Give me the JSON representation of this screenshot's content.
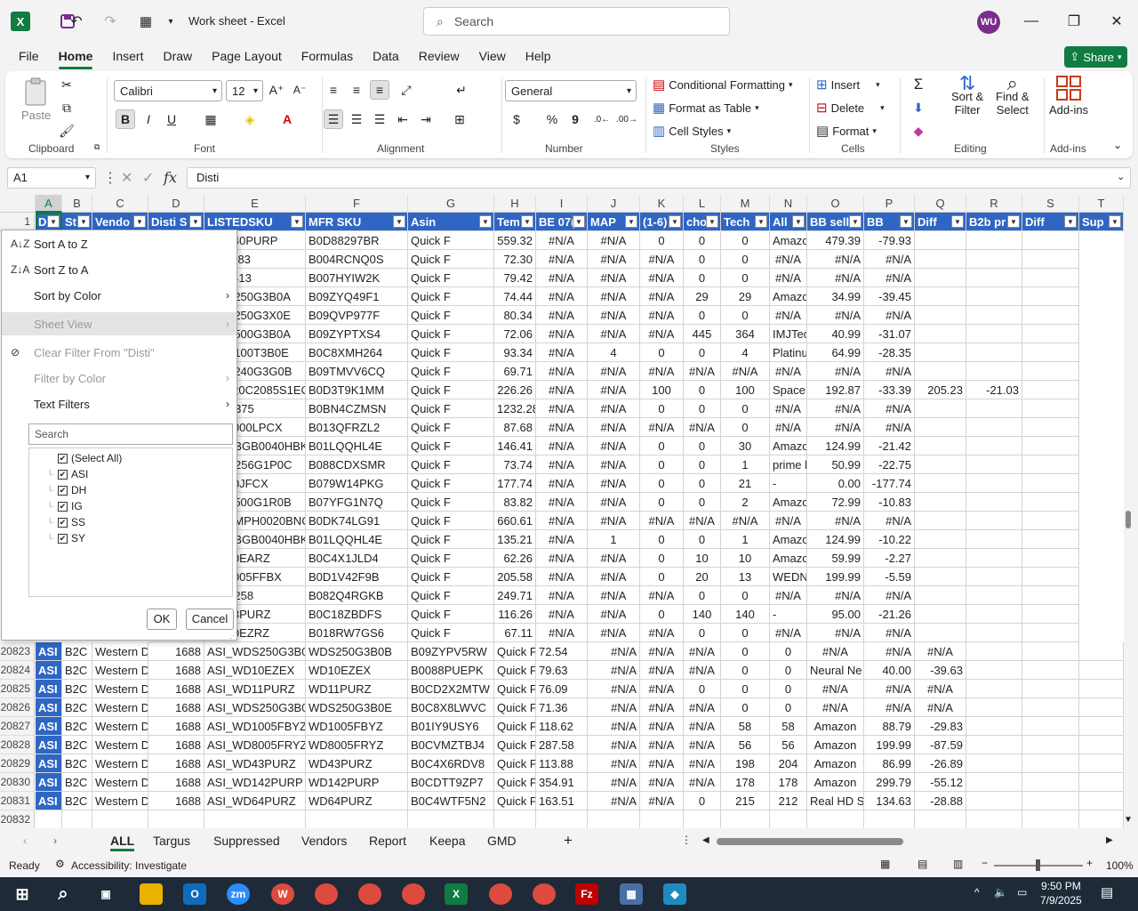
{
  "window": {
    "title": "Work sheet  -  Excel",
    "search_placeholder": "Search",
    "avatar_initials": "WU"
  },
  "menu": [
    "File",
    "Home",
    "Insert",
    "Draw",
    "Page Layout",
    "Formulas",
    "Data",
    "Review",
    "View",
    "Help"
  ],
  "share_label": "Share",
  "ribbon": {
    "clipboard": {
      "paste": "Paste",
      "label": "Clipboard"
    },
    "font": {
      "name": "Calibri",
      "size": "12",
      "label": "Font"
    },
    "alignment": {
      "label": "Alignment"
    },
    "number": {
      "format": "General",
      "label": "Number"
    },
    "styles": {
      "conditional": "Conditional Formatting",
      "table": "Format as Table",
      "cell": "Cell Styles",
      "label": "Styles"
    },
    "cells": {
      "insert": "Insert",
      "delete": "Delete",
      "format": "Format",
      "label": "Cells"
    },
    "editing": {
      "sort": "Sort &",
      "filter": "Filter",
      "find": "Find &",
      "select": "Select",
      "label": "Editing"
    },
    "addins": {
      "btn": "Add-ins",
      "label": "Add-ins"
    }
  },
  "formula_bar": {
    "name_box": "A1",
    "content": "Disti"
  },
  "columns": [
    "A",
    "B",
    "C",
    "D",
    "E",
    "F",
    "G",
    "H",
    "I",
    "J",
    "K",
    "L",
    "M",
    "N",
    "O",
    "P",
    "Q",
    "R",
    "S",
    "T"
  ],
  "headers": [
    "D",
    "St",
    "Vendo",
    "Disti S",
    "LISTEDSKU",
    "MFR SKU",
    "Asin",
    "Tem",
    "BE 07(",
    "MAP",
    "(1-6)",
    "cho",
    "Tech",
    "All",
    "BB sell",
    "BB",
    "Diff",
    "B2b pr",
    "Diff",
    "Sup"
  ],
  "upper_rows": [
    [
      "WD240PURP",
      "WD240PURP",
      "B0D88297BR",
      "Quick F",
      "559.32",
      "#N/A",
      "#N/A",
      "0",
      "0",
      "0",
      "Amazon",
      "479.39",
      "-79.93",
      "",
      ""
    ],
    [
      "0J11283",
      "0J11283",
      "B004RCNQ0S",
      "Quick F",
      "72.30",
      "#N/A",
      "#N/A",
      "#N/A",
      "0",
      "0",
      "#N/A",
      "#N/A",
      "#N/A",
      "",
      ""
    ],
    [
      "0J22413",
      "0J22413",
      "B007HYIW2K",
      "Quick F",
      "79.42",
      "#N/A",
      "#N/A",
      "#N/A",
      "0",
      "0",
      "#N/A",
      "#N/A",
      "#N/A",
      "",
      ""
    ],
    [
      "WDS250G3B0A",
      "WDS250G3B0A",
      "B09ZYQ49F1",
      "Quick F",
      "74.44",
      "#N/A",
      "#N/A",
      "#N/A",
      "29",
      "29",
      "Amazon",
      "34.99",
      "-39.45",
      "",
      ""
    ],
    [
      "WDS250G3X0E",
      "WDS250G3X0E",
      "B09QVP977F",
      "Quick F",
      "80.34",
      "#N/A",
      "#N/A",
      "#N/A",
      "0",
      "0",
      "#N/A",
      "#N/A",
      "#N/A",
      "",
      ""
    ],
    [
      "WDS500G3B0A",
      "WDS500G3B0A",
      "B09ZYPTXS4",
      "Quick F",
      "72.06",
      "#N/A",
      "#N/A",
      "#N/A",
      "445",
      "364",
      "IMJTech (S",
      "40.99",
      "-31.07",
      "",
      ""
    ],
    [
      "WDS100T3B0E",
      "WDS100T3B0E",
      "B0C8XMH264",
      "Quick F",
      "93.34",
      "#N/A",
      "4",
      "0",
      "0",
      "4",
      "Platinum M",
      "64.99",
      "-28.35",
      "",
      ""
    ],
    [
      "WDS240G3G0B",
      "WDS240G3G0B",
      "B09TMVV6CQ",
      "Quick F",
      "69.71",
      "#N/A",
      "#N/A",
      "#N/A",
      "#N/A",
      "#N/A",
      "#N/A",
      "#N/A",
      "#N/A",
      "",
      ""
    ],
    [
      "2B_MTC20C2",
      "MTC20C2085S1EC5",
      "B0D3T9K1MM",
      "Quick F",
      "226.26",
      "#N/A",
      "#N/A",
      "100",
      "0",
      "100",
      "SpaceBou",
      "192.87",
      "-33.39",
      "205.23",
      "-21.03"
    ],
    [
      "0TS2375",
      "0TS2375",
      "B0BN4CZMSN",
      "Quick F",
      "1232.28",
      "#N/A",
      "#N/A",
      "0",
      "0",
      "0",
      "#N/A",
      "#N/A",
      "#N/A",
      "",
      ""
    ],
    [
      "WD5000LPCX",
      "WD5000LPCX",
      "B013QFRZL2",
      "Quick F",
      "87.68",
      "#N/A",
      "#N/A",
      "#N/A",
      "#N/A",
      "0",
      "#N/A",
      "#N/A",
      "#N/A",
      "",
      ""
    ],
    [
      "WDBBGB0040H",
      "WDBBGB0040HBK-",
      "B01LQQHL4E",
      "Quick F",
      "146.41",
      "#N/A",
      "#N/A",
      "0",
      "0",
      "30",
      "Amazon",
      "124.99",
      "-21.42",
      "",
      ""
    ],
    [
      "WDD256G1P0C",
      "WDD256G1P0C",
      "B088CDXSMR",
      "Quick F",
      "73.74",
      "#N/A",
      "#N/A",
      "0",
      "0",
      "1",
      "prime bay",
      "50.99",
      "-22.75",
      "",
      ""
    ],
    [
      "WD10JFCX",
      "WD10JFCX",
      "B079W14PKG",
      "Quick F",
      "177.74",
      "#N/A",
      "#N/A",
      "0",
      "0",
      "21",
      "-",
      "0.00",
      "-177.74",
      "",
      ""
    ],
    [
      "WDS500G1R0B",
      "WDS500G1R0B",
      "B07YFG1N7Q",
      "Quick F",
      "83.82",
      "#N/A",
      "#N/A",
      "0",
      "0",
      "2",
      "Amazon",
      "72.99",
      "-10.83",
      "",
      ""
    ],
    [
      "WDBMPH0020E",
      "WDBMPH0020BNC",
      "B0DK74LG91",
      "Quick F",
      "660.61",
      "#N/A",
      "#N/A",
      "#N/A",
      "#N/A",
      "#N/A",
      "#N/A",
      "#N/A",
      "#N/A",
      "",
      ""
    ],
    [
      "WDBBGB0040I",
      "WDBBGB0040HBK-",
      "B01LQQHL4E",
      "Quick F",
      "135.21",
      "#N/A",
      "1",
      "0",
      "0",
      "1",
      "Amazon",
      "124.99",
      "-10.22",
      "",
      ""
    ],
    [
      "WD20EARZ",
      "WD20EARZ",
      "B0C4X1JLD4",
      "Quick F",
      "62.26",
      "#N/A",
      "#N/A",
      "0",
      "10",
      "10",
      "Amazon",
      "59.99",
      "-2.27",
      "",
      ""
    ],
    [
      "WD6005FFBX",
      "WD6005FFBX",
      "B0D1V42F9B",
      "Quick F",
      "205.58",
      "#N/A",
      "#N/A",
      "0",
      "20",
      "13",
      "WEDNET L",
      "199.99",
      "-5.59",
      "",
      ""
    ],
    [
      "0B42258",
      "0B42258",
      "B082Q4RGKB",
      "Quick F",
      "249.71",
      "#N/A",
      "#N/A",
      "#N/A",
      "0",
      "0",
      "#N/A",
      "#N/A",
      "#N/A",
      "",
      ""
    ],
    [
      "WD33PURZ",
      "WD33PURZ",
      "B0C18ZBDFS",
      "Quick F",
      "116.26",
      "#N/A",
      "#N/A",
      "0",
      "140",
      "140",
      "-",
      "95.00",
      "-21.26",
      "",
      ""
    ],
    [
      "WD10EZRZ",
      "WD10EZRZ",
      "B018RW7GS6",
      "Quick F",
      "67.11",
      "#N/A",
      "#N/A",
      "#N/A",
      "0",
      "0",
      "#N/A",
      "#N/A",
      "#N/A",
      "",
      ""
    ]
  ],
  "lower_rows": [
    [
      "20823",
      "ASI",
      "B2C",
      "Western D",
      "1688",
      "ASI_WDS250G3B0B",
      "WDS250G3B0B",
      "B09ZYPV5RW",
      "Quick F",
      "72.54",
      "#N/A",
      "#N/A",
      "#N/A",
      "0",
      "0",
      "#N/A",
      "#N/A",
      "#N/A"
    ],
    [
      "20824",
      "ASI",
      "B2C",
      "Western D",
      "1688",
      "ASI_WD10EZEX",
      "WD10EZEX",
      "B0088PUEPK",
      "Quick F",
      "79.63",
      "#N/A",
      "#N/A",
      "#N/A",
      "0",
      "0",
      "Neural Ne",
      "40.00",
      "-39.63"
    ],
    [
      "20825",
      "ASI",
      "B2C",
      "Western D",
      "1688",
      "ASI_WD11PURZ",
      "WD11PURZ",
      "B0CD2X2MTW",
      "Quick F",
      "76.09",
      "#N/A",
      "#N/A",
      "0",
      "0",
      "0",
      "#N/A",
      "#N/A",
      "#N/A"
    ],
    [
      "20826",
      "ASI",
      "B2C",
      "Western D",
      "1688",
      "ASI_WDS250G3B0E",
      "WDS250G3B0E",
      "B0C8X8LWVC",
      "Quick F",
      "71.36",
      "#N/A",
      "#N/A",
      "#N/A",
      "0",
      "0",
      "#N/A",
      "#N/A",
      "#N/A"
    ],
    [
      "20827",
      "ASI",
      "B2C",
      "Western D",
      "1688",
      "ASI_WD1005FBYZ",
      "WD1005FBYZ",
      "B01IY9USY6",
      "Quick F",
      "118.62",
      "#N/A",
      "#N/A",
      "#N/A",
      "58",
      "58",
      "Amazon",
      "88.79",
      "-29.83"
    ],
    [
      "20828",
      "ASI",
      "B2C",
      "Western D",
      "1688",
      "ASI_WD8005FRYZ",
      "WD8005FRYZ",
      "B0CVMZTBJ4",
      "Quick F",
      "287.58",
      "#N/A",
      "#N/A",
      "#N/A",
      "56",
      "56",
      "Amazon",
      "199.99",
      "-87.59"
    ],
    [
      "20829",
      "ASI",
      "B2C",
      "Western D",
      "1688",
      "ASI_WD43PURZ",
      "WD43PURZ",
      "B0C4X6RDV8",
      "Quick F",
      "113.88",
      "#N/A",
      "#N/A",
      "#N/A",
      "198",
      "204",
      "Amazon",
      "86.99",
      "-26.89"
    ],
    [
      "20830",
      "ASI",
      "B2C",
      "Western D",
      "1688",
      "ASI_WD142PURP",
      "WD142PURP",
      "B0CDTT9ZP7",
      "Quick F",
      "354.91",
      "#N/A",
      "#N/A",
      "#N/A",
      "178",
      "178",
      "Amazon",
      "299.79",
      "-55.12"
    ],
    [
      "20831",
      "ASI",
      "B2C",
      "Western D",
      "1688",
      "ASI_WD64PURZ",
      "WD64PURZ",
      "B0C4WTF5N2",
      "Quick F",
      "163.51",
      "#N/A",
      "#N/A",
      "0",
      "215",
      "212",
      "Real HD St",
      "134.63",
      "-28.88"
    ],
    [
      "20832",
      "",
      "",
      "",
      "",
      "",
      "",
      "",
      "",
      "",
      "",
      "",
      "",
      "",
      "",
      "",
      "",
      ""
    ]
  ],
  "filter_menu": {
    "sort_az": "Sort A to Z",
    "sort_za": "Sort Z to A",
    "sort_color": "Sort by Color",
    "sheet_view": "Sheet View",
    "clear_filter": "Clear Filter From \"Disti\"",
    "filter_color": "Filter by Color",
    "text_filters": "Text Filters",
    "search_placeholder": "Search",
    "values": [
      "(Select All)",
      "ASI",
      "DH",
      "IG",
      "SS",
      "SY"
    ],
    "ok": "OK",
    "cancel": "Cancel"
  },
  "sheets": [
    "ALL",
    "Targus",
    "Suppressed",
    "Vendors",
    "Report",
    "Keepa",
    "GMD"
  ],
  "status": {
    "ready": "Ready",
    "accessibility": "Accessibility: Investigate",
    "zoom": "100%"
  },
  "clock": {
    "time": "9:50 PM",
    "date": "7/9/2025"
  },
  "colors": {
    "accent": "#107c41",
    "header_fill": "#2f66c4"
  }
}
